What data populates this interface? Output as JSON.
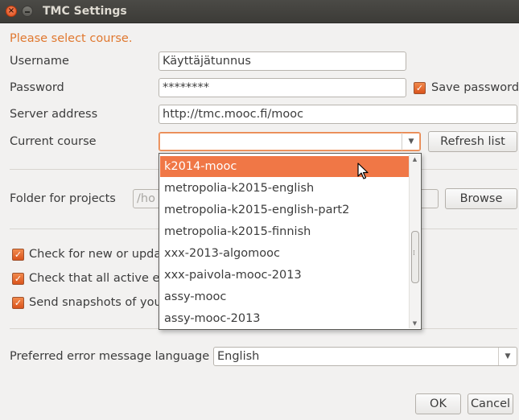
{
  "window": {
    "title": "TMC Settings",
    "close_glyph": "×"
  },
  "form": {
    "warning": "Please select course.",
    "username_label": "Username",
    "username_value": "Käyttäjätunnus",
    "password_label": "Password",
    "password_value": "********",
    "save_password_label": "Save password",
    "server_label": "Server address",
    "server_value": "http://tmc.mooc.fi/mooc",
    "course_label": "Current course",
    "course_value": "",
    "refresh_label": "Refresh list",
    "folder_label": "Folder for projects",
    "folder_value": "/ho",
    "browse_label": "Browse",
    "check1_label": "Check for new or upda",
    "check2_label": "Check that all active ex",
    "check3_label": "Send snapshots of your",
    "language_label": "Preferred error message language",
    "language_value": "English",
    "ok_label": "OK",
    "cancel_label": "Cancel"
  },
  "course_dropdown": {
    "items": [
      "k2014-mooc",
      "metropolia-k2015-english",
      "metropolia-k2015-english-part2",
      "metropolia-k2015-finnish",
      "xxx-2013-algomooc",
      "xxx-paivola-mooc-2013",
      "assy-mooc",
      "assy-mooc-2013"
    ],
    "highlighted_index": 0
  },
  "icons": {
    "dropdown_arrow": "▼",
    "scroll_up": "▲",
    "scroll_down": "▼",
    "checkmark": "✓"
  },
  "colors": {
    "accent": "#f07746",
    "warning_text": "#e0782f",
    "titlebar": "#3c3b37"
  }
}
